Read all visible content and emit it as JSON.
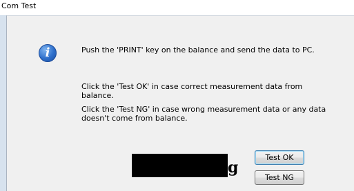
{
  "window": {
    "title": "Com Test"
  },
  "dialog": {
    "icon": "info-icon",
    "messages": [
      "Push the 'PRINT' key on the balance and send the data to PC.",
      "Click the 'Test OK' in case correct measurement data from balance.",
      "Click the 'Test NG' in case wrong measurement data or any data doesn't come from balance."
    ],
    "unit": "g"
  },
  "buttons": {
    "test_ok": "Test OK",
    "test_ng": "Test NG"
  },
  "colors": {
    "dialog_background": "#f0f0f0",
    "default_button_border": "#3c7fb1",
    "info_icon_blue": "#2e6fcb"
  }
}
